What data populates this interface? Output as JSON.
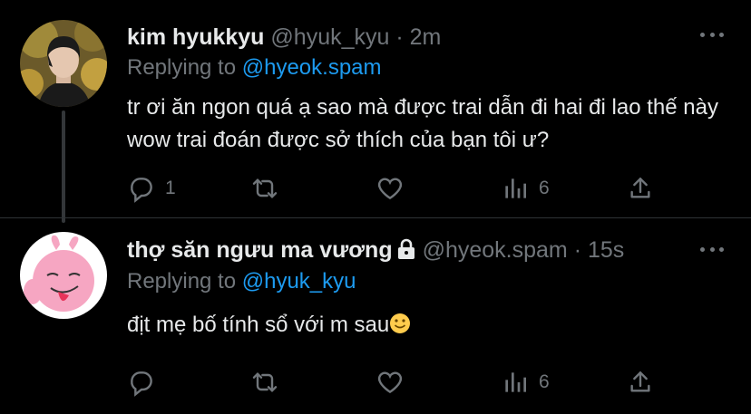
{
  "tweets": [
    {
      "display_name": "kim hyukkyu",
      "handle": "@hyuk_kyu",
      "time": "· 2m",
      "replying_prefix": "Replying to",
      "replying_to": "@hyeok.spam",
      "text": "tr ơi ăn ngon quá ạ sao mà được trai dẫn đi hai đi lao thế này wow trai đoán được sở thích của bạn tôi ư?",
      "reply_count": "1",
      "retweet_count": "",
      "like_count": "",
      "view_count": "6",
      "protected": false
    },
    {
      "display_name": "thợ săn ngưu ma vương",
      "handle": "@hyeok.spam",
      "time": "· 15s",
      "replying_prefix": "Replying to",
      "replying_to": "@hyuk_kyu",
      "text": "địt mẹ bố tính sổ với m sau",
      "reply_count": "",
      "retweet_count": "",
      "like_count": "",
      "view_count": "6",
      "protected": true,
      "trailing_emoji": "slightly-smiling-face-emoji"
    }
  ],
  "icons": {
    "reply": "reply-icon",
    "retweet": "retweet-icon",
    "like": "heart-icon",
    "views": "views-icon",
    "share": "share-icon",
    "more": "more-icon",
    "lock": "lock-icon"
  },
  "colors": {
    "background": "#000000",
    "text": "#e7e9ea",
    "muted": "#71767b",
    "link": "#1d9bf0"
  }
}
